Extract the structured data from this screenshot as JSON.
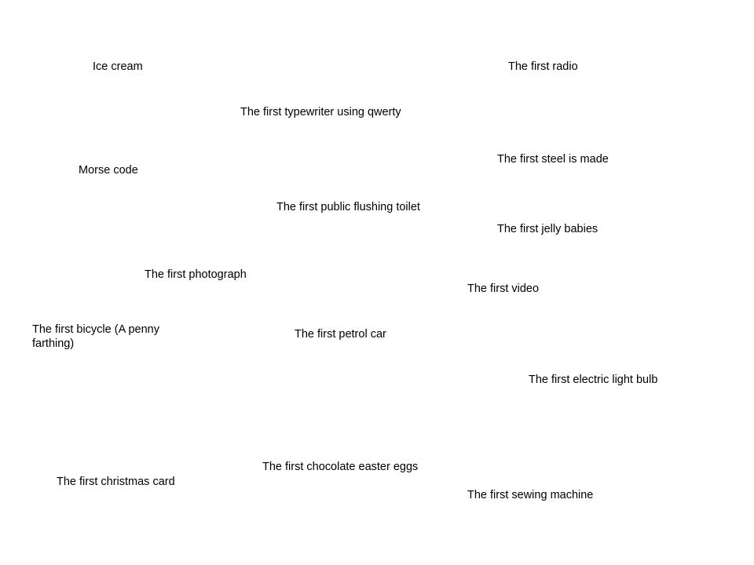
{
  "items": [
    {
      "text": "Ice cream"
    },
    {
      "text": "The first radio"
    },
    {
      "text": "The first typewriter using qwerty"
    },
    {
      "text": "The first steel is made"
    },
    {
      "text": "Morse code"
    },
    {
      "text": "The first public flushing toilet"
    },
    {
      "text": "The first jelly babies"
    },
    {
      "text": "The first photograph"
    },
    {
      "text": "The first video"
    },
    {
      "text": "The first bicycle (A penny farthing)"
    },
    {
      "text": "The first petrol car"
    },
    {
      "text": "The first electric light bulb"
    },
    {
      "text": "The first chocolate easter eggs"
    },
    {
      "text": "The first christmas card"
    },
    {
      "text": "The first sewing machine"
    }
  ]
}
